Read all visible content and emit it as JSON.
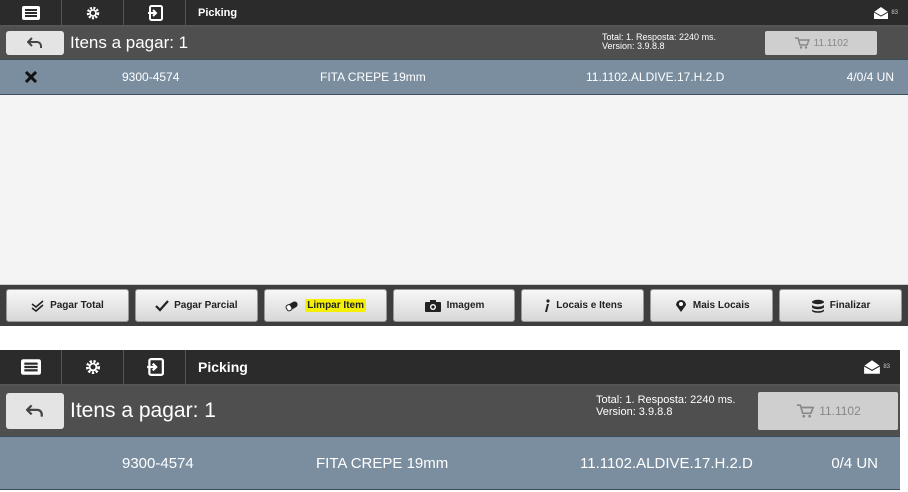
{
  "screen1": {
    "toolbar": {
      "title": "Picking",
      "mail_badge": "83"
    },
    "header": {
      "items_label": "Itens a pagar: 1",
      "info_line1": "Total: 1. Resposta: 2240 ms.",
      "info_line2": "Version: 3.9.8.8",
      "cart_label": "11.1102"
    },
    "row": {
      "code": "9300-4574",
      "description": "FITA CREPE 19mm",
      "location": "11.1102.ALDIVE.17.H.2.D",
      "quantity": "4/0/4 UN"
    },
    "actions": {
      "pagar_total": "Pagar Total",
      "pagar_parcial": "Pagar Parcial",
      "limpar_item": "Limpar Item",
      "imagem": "Imagem",
      "locais_itens": "Locais e Itens",
      "mais_locais": "Mais Locais",
      "finalizar": "Finalizar"
    },
    "colors": {
      "highlight": "#f4f000",
      "row": "#7a8ea0"
    }
  },
  "screen2": {
    "toolbar": {
      "title": "Picking",
      "mail_badge": "83"
    },
    "header": {
      "items_label": "Itens a pagar: 1",
      "info_line1": "Total: 1. Resposta: 2240 ms.",
      "info_line2": "Version: 3.9.8.8",
      "cart_label": "11.1102"
    },
    "row": {
      "code": "9300-4574",
      "description": "FITA CREPE 19mm",
      "location": "11.1102.ALDIVE.17.H.2.D",
      "quantity": "0/4 UN"
    }
  }
}
